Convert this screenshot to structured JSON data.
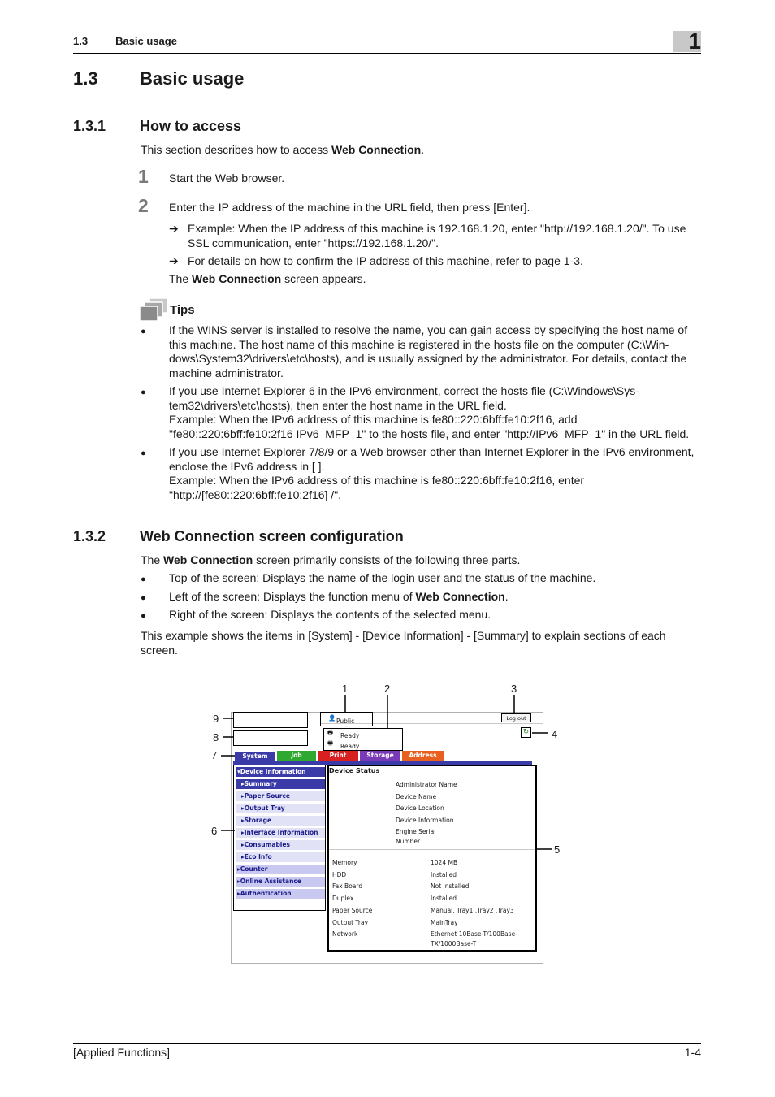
{
  "header": {
    "section_num": "1.3",
    "section_title": "Basic usage",
    "chapter": "1"
  },
  "title": {
    "num": "1.3",
    "text": "Basic usage"
  },
  "s1": {
    "num": "1.3.1",
    "title": "How to access",
    "intro_a": "This section describes how to access ",
    "intro_b": "Web Connection",
    "intro_c": ".",
    "step1_num": "1",
    "step1": "Start the Web browser.",
    "step2_num": "2",
    "step2": "Enter the IP address of the machine in the URL field, then press [Enter].",
    "arrow1": "Example: When the IP address of this machine is 192.168.1.20, enter \"http://192.168.1.20/\". To use SSL communication, enter \"https://192.168.1.20/\".",
    "arrow2": "For details on how to confirm the IP address of this machine, refer to page 1-3.",
    "appear_a": "The ",
    "appear_b": "Web Connection",
    "appear_c": " screen appears."
  },
  "tips": {
    "label": "Tips",
    "b1": "If the WINS server is installed to resolve the name, you can gain access by specifying the host name of this machine. The host name of this machine is registered in the hosts file on the computer (C:\\Win-dows\\System32\\drivers\\etc\\hosts), and is usually assigned by the administrator. For details, contact the machine administrator.",
    "b2a": "If you use Internet Explorer 6 in the IPv6 environment, correct the hosts file (C:\\Windows\\Sys-tem32\\drivers\\etc\\hosts), then enter the host name in the URL field.",
    "b2b": "Example: When the IPv6 address of this machine is fe80::220:6bff:fe10:2f16, add \"fe80::220:6bff:fe10:2f16 IPv6_MFP_1\" to the hosts file, and enter \"http://IPv6_MFP_1\" in the URL field.",
    "b3a": "If you use Internet Explorer 7/8/9 or a Web browser other than Internet Explorer in the IPv6 environment, enclose the IPv6 address in [ ].",
    "b3b": "Example: When the IPv6 address of this machine is fe80::220:6bff:fe10:2f16, enter \"http://[fe80::220:6bff:fe10:2f16] /\"."
  },
  "s2": {
    "num": "1.3.2",
    "title": "Web Connection screen configuration",
    "intro_a": "The ",
    "intro_b": "Web Connection",
    "intro_c": " screen primarily consists of the following three parts.",
    "b1": "Top of the screen: Displays the name of the login user and the status of the machine.",
    "b2a": "Left of the screen: Displays the function menu of ",
    "b2b": "Web Connection",
    "b2c": ".",
    "b3": "Right of the screen: Displays the contents of the selected menu.",
    "example": "This example shows the items in [System] - [Device Information] - [Summary] to explain sections of each screen."
  },
  "figure": {
    "callouts": [
      "1",
      "2",
      "3",
      "4",
      "5",
      "6",
      "7",
      "8",
      "9"
    ],
    "user": "Public",
    "status1": "Ready",
    "status2": "Ready",
    "logout": "Log out",
    "tabs": [
      "System",
      "Job",
      "Print",
      "Storage",
      "Address"
    ],
    "tab_colors": [
      "#3a3aa8",
      "#2ea82e",
      "#d82020",
      "#7a3ab8",
      "#e86020"
    ],
    "menu": [
      {
        "label": "▾Device Information",
        "level": 0,
        "selected": true
      },
      {
        "label": "▸Summary",
        "level": 1,
        "selected": true
      },
      {
        "label": "▸Paper Source",
        "level": 1
      },
      {
        "label": "▸Output Tray",
        "level": 1
      },
      {
        "label": "▸Storage",
        "level": 1
      },
      {
        "label": "▸Interface Information",
        "level": 1
      },
      {
        "label": "▸Consumables",
        "level": 1
      },
      {
        "label": "▸Eco Info",
        "level": 1
      },
      {
        "label": "▸Counter",
        "level": 0
      },
      {
        "label": "▸Online Assistance",
        "level": 0
      },
      {
        "label": "▸Authentication",
        "level": 0
      }
    ],
    "panel_title": "Device Status",
    "top_fields": [
      "Administrator Name",
      "Device Name",
      "Device Location",
      "Device Information",
      "Engine Serial",
      "Number"
    ],
    "rows": [
      {
        "k": "Memory",
        "v": "1024 MB"
      },
      {
        "k": "HDD",
        "v": "Installed"
      },
      {
        "k": "Fax Board",
        "v": "Not Installed"
      },
      {
        "k": "Duplex",
        "v": "Installed"
      },
      {
        "k": "Paper Source",
        "v": "Manual, Tray1 ,Tray2 ,Tray3"
      },
      {
        "k": "Output Tray",
        "v": "MainTray"
      },
      {
        "k": "Network",
        "v": "Ethernet 10Base-T/100Base-"
      }
    ],
    "network_cont": "TX/1000Base-T"
  },
  "footer": {
    "left": "[Applied Functions]",
    "right": "1-4"
  }
}
